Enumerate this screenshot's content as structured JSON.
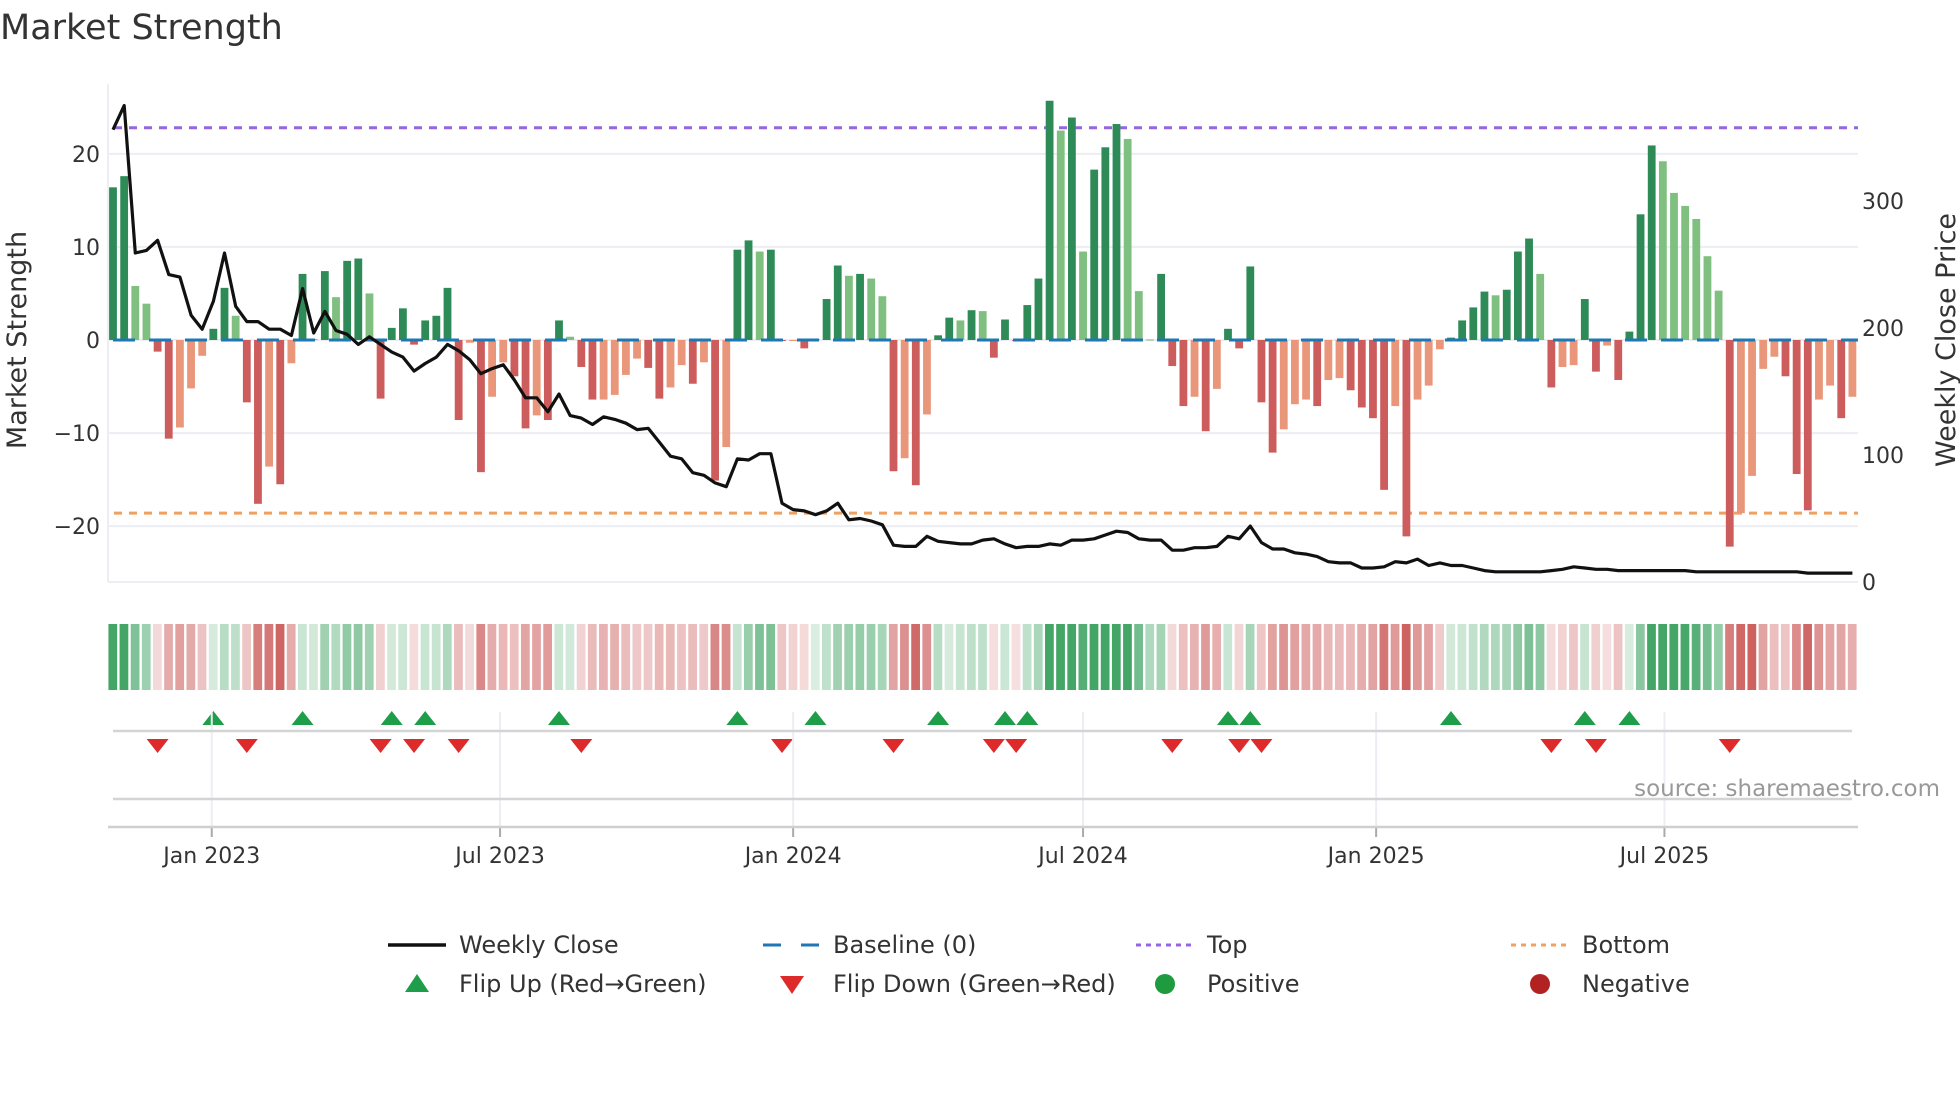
{
  "chart_data": {
    "type": "bar",
    "title": "Market Strength",
    "ylabel": "Market Strength",
    "y2label": "Weekly Close Price",
    "ylim": [
      -26,
      27.5
    ],
    "y2lim": [
      0,
      392
    ],
    "yticks": [
      {
        "v": 20,
        "label": "20"
      },
      {
        "v": 10,
        "label": "10"
      },
      {
        "v": 0,
        "label": "0"
      },
      {
        "v": -10,
        "label": "−10"
      },
      {
        "v": -20,
        "label": "−20"
      }
    ],
    "y2ticks": [
      {
        "v": 0,
        "label": "0"
      },
      {
        "v": 100,
        "label": "100"
      },
      {
        "v": 200,
        "label": "200"
      },
      {
        "v": 300,
        "label": "300"
      }
    ],
    "x_start": "2022-10-31",
    "x_frequency": "weekly",
    "xticks": [
      {
        "date": "2023-01-01",
        "label": "Jan 2023"
      },
      {
        "date": "2023-07-01",
        "label": "Jul 2023"
      },
      {
        "date": "2024-01-01",
        "label": "Jan 2024"
      },
      {
        "date": "2024-07-01",
        "label": "Jul 2024"
      },
      {
        "date": "2025-01-01",
        "label": "Jan 2025"
      },
      {
        "date": "2025-07-01",
        "label": "Jul 2025"
      }
    ],
    "top_level": 22.8,
    "bottom_level": -18.6,
    "baseline": 0,
    "strength": [
      16.4,
      17.6,
      5.8,
      3.9,
      -1.25,
      -10.6,
      -9.4,
      -5.2,
      -1.7,
      1.2,
      5.6,
      2.6,
      -6.7,
      -17.6,
      -13.6,
      -15.5,
      -2.5,
      7.1,
      0.1,
      7.4,
      4.6,
      8.5,
      8.75,
      5.0,
      -6.3,
      1.3,
      3.4,
      -0.5,
      2.1,
      2.6,
      5.6,
      -8.6,
      -0.3,
      -14.2,
      -6.1,
      -2.4,
      -3.9,
      -9.5,
      -8.1,
      -8.6,
      2.1,
      0.35,
      -2.9,
      -6.4,
      -6.4,
      -5.9,
      -3.75,
      -2.0,
      -3.0,
      -6.3,
      -5.1,
      -2.7,
      -4.7,
      -2.4,
      -15.1,
      -11.5,
      9.7,
      10.7,
      9.5,
      9.7,
      -0.1,
      -0.05,
      -0.9,
      0.1,
      4.4,
      8.0,
      6.9,
      7.1,
      6.6,
      4.7,
      -14.1,
      -12.7,
      -15.6,
      -8.0,
      0.5,
      2.4,
      2.1,
      3.2,
      3.1,
      -1.9,
      2.2,
      -0.1,
      3.75,
      6.6,
      25.7,
      22.5,
      23.9,
      9.5,
      18.3,
      20.7,
      23.2,
      21.6,
      5.25,
      0.05,
      7.1,
      -2.8,
      -7.1,
      -6.1,
      -9.8,
      -5.25,
      1.2,
      -0.9,
      7.9,
      -6.7,
      -12.1,
      -9.6,
      -6.9,
      -6.4,
      -7.1,
      -4.3,
      -4.1,
      -5.4,
      -7.25,
      -8.4,
      -16.1,
      -7.1,
      -21.1,
      -6.4,
      -4.9,
      -1.0,
      0.25,
      2.1,
      3.5,
      5.2,
      4.8,
      5.4,
      9.5,
      10.9,
      7.1,
      -5.1,
      -2.9,
      -2.7,
      4.4,
      -3.4,
      -0.6,
      -4.3,
      0.9,
      13.5,
      20.9,
      19.2,
      15.8,
      14.4,
      13.0,
      9.0,
      5.3,
      -22.2,
      -18.6,
      -14.6,
      -3.1,
      -1.8,
      -3.9,
      -14.4,
      -18.3,
      -6.4,
      -4.9,
      -8.4,
      -6.1
    ],
    "weekly_close": [
      356,
      375,
      259,
      261,
      269,
      242,
      240,
      210,
      199,
      221,
      259,
      217,
      205,
      205,
      199,
      199,
      194,
      231,
      196,
      213,
      198,
      195,
      187,
      193,
      187,
      181,
      177,
      166,
      172,
      177,
      187,
      182,
      175,
      164,
      168,
      171,
      159,
      145,
      145,
      134,
      148,
      131,
      129,
      124,
      130,
      128,
      125,
      120,
      121,
      110,
      99,
      97,
      86,
      84,
      78,
      75,
      97,
      96,
      101,
      101,
      62,
      57,
      56,
      53,
      56,
      62,
      49,
      50,
      48,
      45,
      29,
      28,
      28,
      36,
      32,
      31,
      30,
      30,
      33,
      34,
      30,
      27,
      28,
      28,
      30,
      29,
      33,
      33,
      34,
      37,
      40,
      39,
      34,
      33,
      33,
      25,
      25,
      27,
      27,
      28,
      36,
      34,
      44,
      31,
      26,
      26,
      23,
      22,
      20,
      16,
      15,
      15,
      11,
      11,
      12,
      16,
      15,
      18,
      13,
      15,
      13,
      13,
      11,
      9,
      8,
      8,
      8,
      8,
      8,
      9,
      10,
      12,
      11,
      10,
      10,
      9,
      9,
      9,
      9,
      9,
      9,
      9,
      8,
      8,
      8,
      8,
      8,
      8,
      8,
      8,
      8,
      8,
      7,
      7,
      7,
      7,
      7
    ],
    "legend_placement": "bottom-center",
    "legend": [
      {
        "label": "Weekly Close",
        "kind": "line",
        "color": "#111111"
      },
      {
        "label": "Baseline (0)",
        "kind": "dash",
        "color": "#1f77b4"
      },
      {
        "label": "Top",
        "kind": "dot",
        "color": "#9467e0"
      },
      {
        "label": "Bottom",
        "kind": "dot",
        "color": "#f0a060"
      },
      {
        "label": "Flip Up (Red→Green)",
        "kind": "triangle-up",
        "color": "#1e9e48"
      },
      {
        "label": "Flip Down (Green→Red)",
        "kind": "triangle-down",
        "color": "#dd2a2a"
      },
      {
        "label": "Positive",
        "kind": "circle",
        "color": "#1e9a3f"
      },
      {
        "label": "Negative",
        "kind": "circle",
        "color": "#b22222"
      }
    ],
    "source": "source: sharemaestro.com"
  },
  "colors": {
    "pos_rising": "#2e8b57",
    "pos_falling": "#7fbf7f",
    "neg_falling": "#cd5c5c",
    "neg_rising": "#e9967a",
    "heat_pos": "#2e9b55",
    "heat_neg": "#c8504e"
  }
}
